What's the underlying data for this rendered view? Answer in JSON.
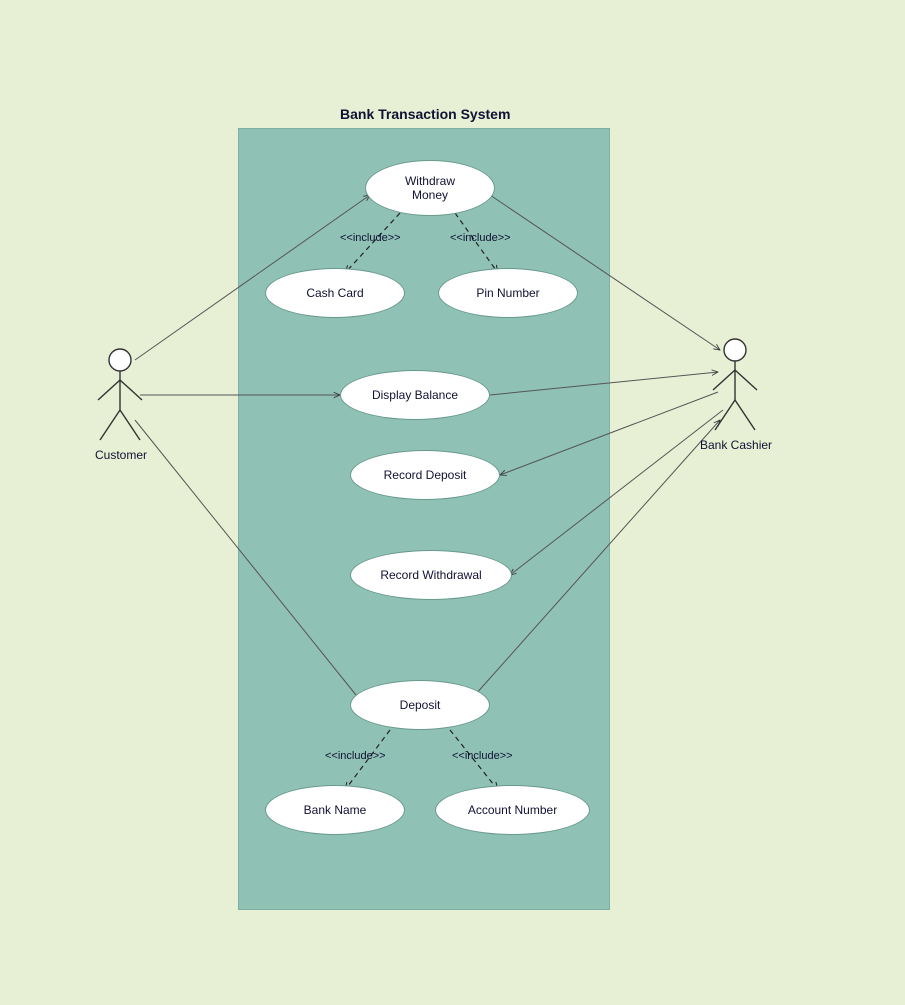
{
  "title": "Bank Transaction System",
  "actors": {
    "customer": "Customer",
    "cashier": "Bank Cashier"
  },
  "usecases": {
    "withdraw": "Withdraw\nMoney",
    "cashcard": "Cash Card",
    "pin": "Pin Number",
    "display": "Display Balance",
    "recdep": "Record Deposit",
    "recwith": "Record Withdrawal",
    "deposit": "Deposit",
    "bankname": "Bank Name",
    "acct": "Account Number"
  },
  "include": "<<include>>"
}
